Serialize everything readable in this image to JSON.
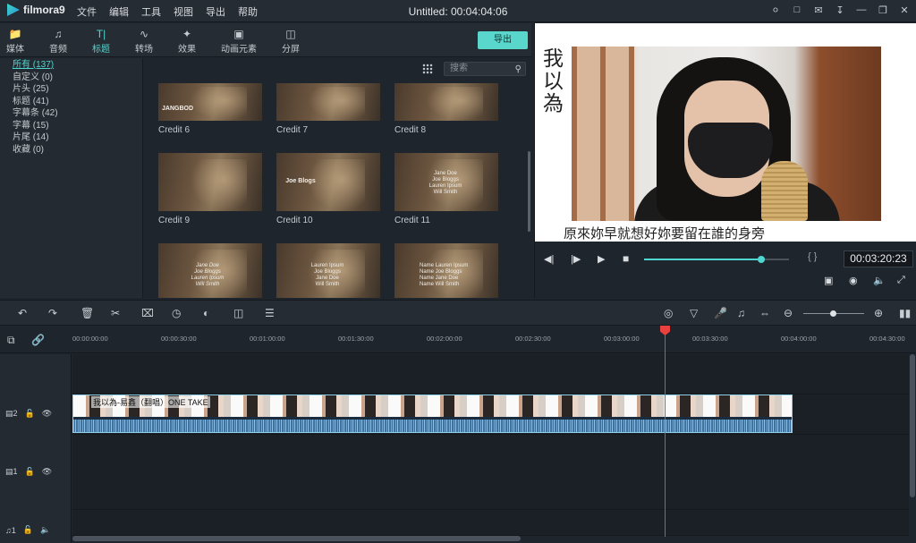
{
  "app": {
    "name": "filmora9",
    "title": "Untitled: 00:04:04:06"
  },
  "menu": [
    "文件",
    "编辑",
    "工具",
    "视图",
    "导出",
    "帮助"
  ],
  "tabs": [
    {
      "label": "媒体",
      "icon": "folder-icon"
    },
    {
      "label": "音频",
      "icon": "music-icon"
    },
    {
      "label": "标题",
      "icon": "text-icon"
    },
    {
      "label": "转场",
      "icon": "transition-icon"
    },
    {
      "label": "效果",
      "icon": "effects-icon"
    },
    {
      "label": "动画元素",
      "icon": "elements-icon"
    },
    {
      "label": "分屏",
      "icon": "split-screen-icon"
    }
  ],
  "export_label": "导出",
  "categories": [
    "所有 (137)",
    "自定义 (0)",
    "片头 (25)",
    "标题 (41)",
    "字幕条 (42)",
    "字幕 (15)",
    "片尾 (14)",
    "收藏 (0)"
  ],
  "search": {
    "placeholder": "搜索"
  },
  "thumbnails": [
    {
      "label": "Credit 6",
      "lines": [
        "JANGBOD"
      ]
    },
    {
      "label": "Credit 7",
      "lines": [
        ""
      ]
    },
    {
      "label": "Credit 8",
      "lines": [
        ""
      ]
    },
    {
      "label": "Credit 9",
      "lines": [
        ""
      ]
    },
    {
      "label": "Credit 10",
      "lines": [
        "Joe Blogs"
      ]
    },
    {
      "label": "Credit 11",
      "lines": [
        "Jane Doe",
        "Joe Bloggs",
        "Lauren Ipsum",
        "Will Smith"
      ]
    },
    {
      "label": "",
      "lines": [
        "Jane Doe",
        "Joe Bloggs",
        "Lauren Ipsum",
        "Will Smith"
      ]
    },
    {
      "label": "",
      "lines": [
        "Lauren Ipsum",
        "Joe Bloggs",
        "Jane Doe",
        "Will Smith"
      ]
    },
    {
      "label": "",
      "lines": [
        "Name  Lauren Ipsum",
        "Name  Joe Bloggs",
        "Name  Jane Doe",
        "Name  Will Smith"
      ]
    }
  ],
  "preview": {
    "vertical_text": "我\n以\n為",
    "subtitle": "原來妳早就想好妳要留在誰的身旁",
    "timecode": "00:03:20:23",
    "progress": 0.81,
    "brackets": "{ }"
  },
  "ruler": [
    "00:00:00:00",
    "00:00:30:00",
    "00:01:00:00",
    "00:01:30:00",
    "00:02:00:00",
    "00:02:30:00",
    "00:03:00:00",
    "00:03:30:00",
    "00:04:00:00",
    "00:04:30:00"
  ],
  "tracks": [
    {
      "label": "2",
      "icon": "video-track-icon"
    },
    {
      "label": "1",
      "icon": "video-track-icon"
    },
    {
      "label": "1",
      "icon": "music-track-icon"
    }
  ],
  "clip": {
    "label": "我以為-易鑫（翻唱）ONE TAKE"
  },
  "colors": {
    "accent": "#4fd6cf",
    "playhead": "#e8413f",
    "clip_border": "#8ed0ea"
  }
}
